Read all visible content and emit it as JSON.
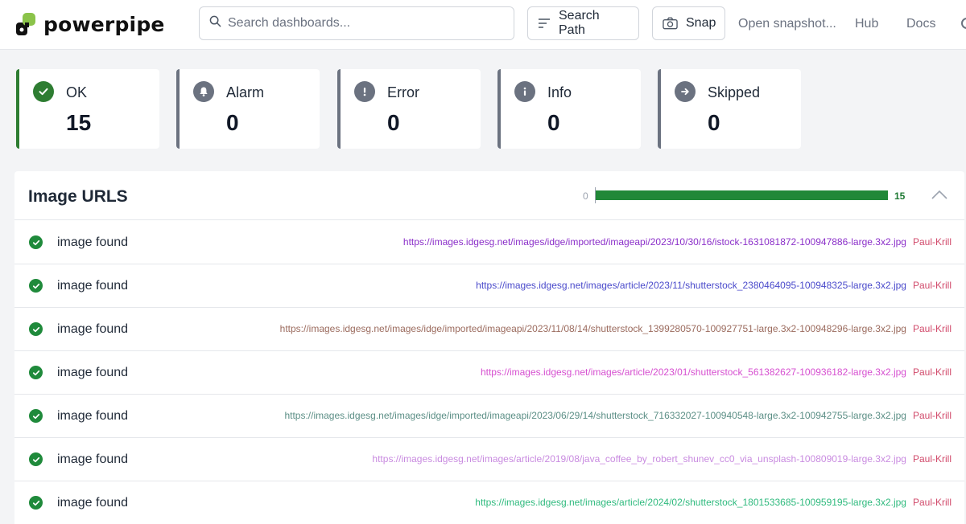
{
  "header": {
    "brand": "powerpipe",
    "search_placeholder": "Search dashboards...",
    "search_path_label": "Search Path",
    "snap_label": "Snap",
    "open_snapshot_label": "Open snapshot...",
    "hub_label": "Hub",
    "docs_label": "Docs"
  },
  "summary": [
    {
      "label": "OK",
      "value": "15",
      "icon": "check-circle-icon",
      "color": "#2e7d32"
    },
    {
      "label": "Alarm",
      "value": "0",
      "icon": "bell-icon",
      "color": "#6b7280"
    },
    {
      "label": "Error",
      "value": "0",
      "icon": "exclamation-icon",
      "color": "#6b7280"
    },
    {
      "label": "Info",
      "value": "0",
      "icon": "info-icon",
      "color": "#6b7280"
    },
    {
      "label": "Skipped",
      "value": "0",
      "icon": "arrow-right-icon",
      "color": "#6b7280"
    }
  ],
  "panel": {
    "title": "Image URLS",
    "progress_min": "0",
    "progress_max": "15",
    "progress_fraction": 1.0,
    "rows": [
      {
        "status": "image found",
        "url": "https://images.idgesg.net/images/idge/imported/imageapi/2023/10/30/16/istock-1631081872-100947886-large.3x2.jpg",
        "tag": "Paul-Krill",
        "color": "#8b2fc9"
      },
      {
        "status": "image found",
        "url": "https://images.idgesg.net/images/article/2023/11/shutterstock_2380464095-100948325-large.3x2.jpg",
        "tag": "Paul-Krill",
        "color": "#4a4acb"
      },
      {
        "status": "image found",
        "url": "https://images.idgesg.net/images/idge/imported/imageapi/2023/11/08/14/shutterstock_1399280570-100927751-large.3x2-100948296-large.3x2.jpg",
        "tag": "Paul-Krill",
        "color": "#9b6b5e"
      },
      {
        "status": "image found",
        "url": "https://images.idgesg.net/images/article/2023/01/shutterstock_561382627-100936182-large.3x2.jpg",
        "tag": "Paul-Krill",
        "color": "#d64fd0"
      },
      {
        "status": "image found",
        "url": "https://images.idgesg.net/images/idge/imported/imageapi/2023/06/29/14/shutterstock_716332027-100940548-large.3x2-100942755-large.3x2.jpg",
        "tag": "Paul-Krill",
        "color": "#5c8f86"
      },
      {
        "status": "image found",
        "url": "https://images.idgesg.net/images/article/2019/08/java_coffee_by_robert_shunev_cc0_via_unsplash-100809019-large.3x2.jpg",
        "tag": "Paul-Krill",
        "color": "#c98be0"
      },
      {
        "status": "image found",
        "url": "https://images.idgesg.net/images/article/2024/02/shutterstock_1801533685-100959195-large.3x2.jpg",
        "tag": "Paul-Krill",
        "color": "#2fba7e"
      }
    ]
  }
}
